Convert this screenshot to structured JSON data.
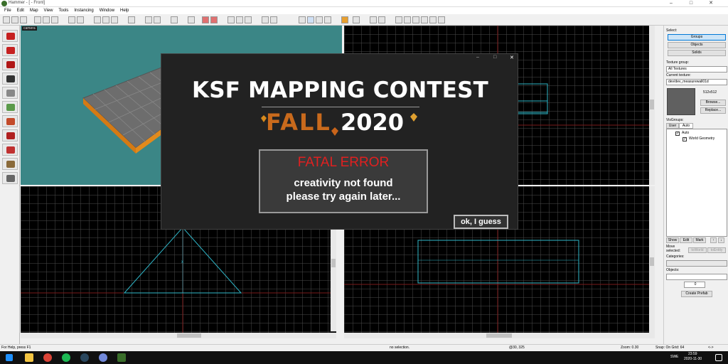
{
  "window": {
    "title": "Hammer - [ - Front]"
  },
  "menu": [
    "File",
    "Edit",
    "Map",
    "View",
    "Tools",
    "Instancing",
    "Window",
    "Help"
  ],
  "viewports": {
    "camera_label": "camera"
  },
  "right_panel": {
    "select_label": "Select:",
    "groups": "Groups",
    "objects": "Objects",
    "solids": "Solids",
    "texture_group_label": "Texture group:",
    "texture_group_value": "All Textures",
    "current_texture_label": "Current texture:",
    "current_texture_value": "dev/dev_measurewall01d",
    "texture_size": "512x512",
    "browse": "Browse...",
    "replace": "Replace...",
    "visgroups_label": "VisGroups:",
    "tab_user": "User",
    "tab_auto": "Auto",
    "tree_auto": "Auto",
    "tree_world": "World Geometry",
    "show": "Show",
    "edit": "Edit",
    "mark": "Mark",
    "move_selected_label": "Move selected:",
    "to_world": "toWorld",
    "to_entity": "toEntity",
    "categories_label": "Categories:",
    "objects_label": "Objects:",
    "stepper_value": "0",
    "create_prefab": "Create Prefab"
  },
  "status": {
    "help": "For Help, press F1",
    "selection": "no selection.",
    "coords": "@30, 325",
    "zoom": "Zoom: 0.30",
    "snap": "Snap: On Grid: 64",
    "arrows": "<->"
  },
  "taskbar": {
    "time": "23:59",
    "date": "2020-11-30",
    "lang": "SWE"
  },
  "dialog": {
    "title_line": "KSF MAPPING CONTEST",
    "season": "FALL",
    "year": "2020",
    "error_heading": "FATAL ERROR",
    "error_line1": "creativity not found",
    "error_line2": "please try again later...",
    "ok_button": "ok, I guess"
  },
  "colors": {
    "viewport_3d": "#3b8686",
    "wire": "#2fb7c9",
    "error_red": "#e02020",
    "fall_orange": "#c96a1c"
  },
  "icons": [
    "hammer-icon",
    "start-icon",
    "search-icon",
    "chrome-icon",
    "spotify-icon",
    "steam-icon",
    "discord-icon",
    "hammer-taskbar-icon"
  ]
}
